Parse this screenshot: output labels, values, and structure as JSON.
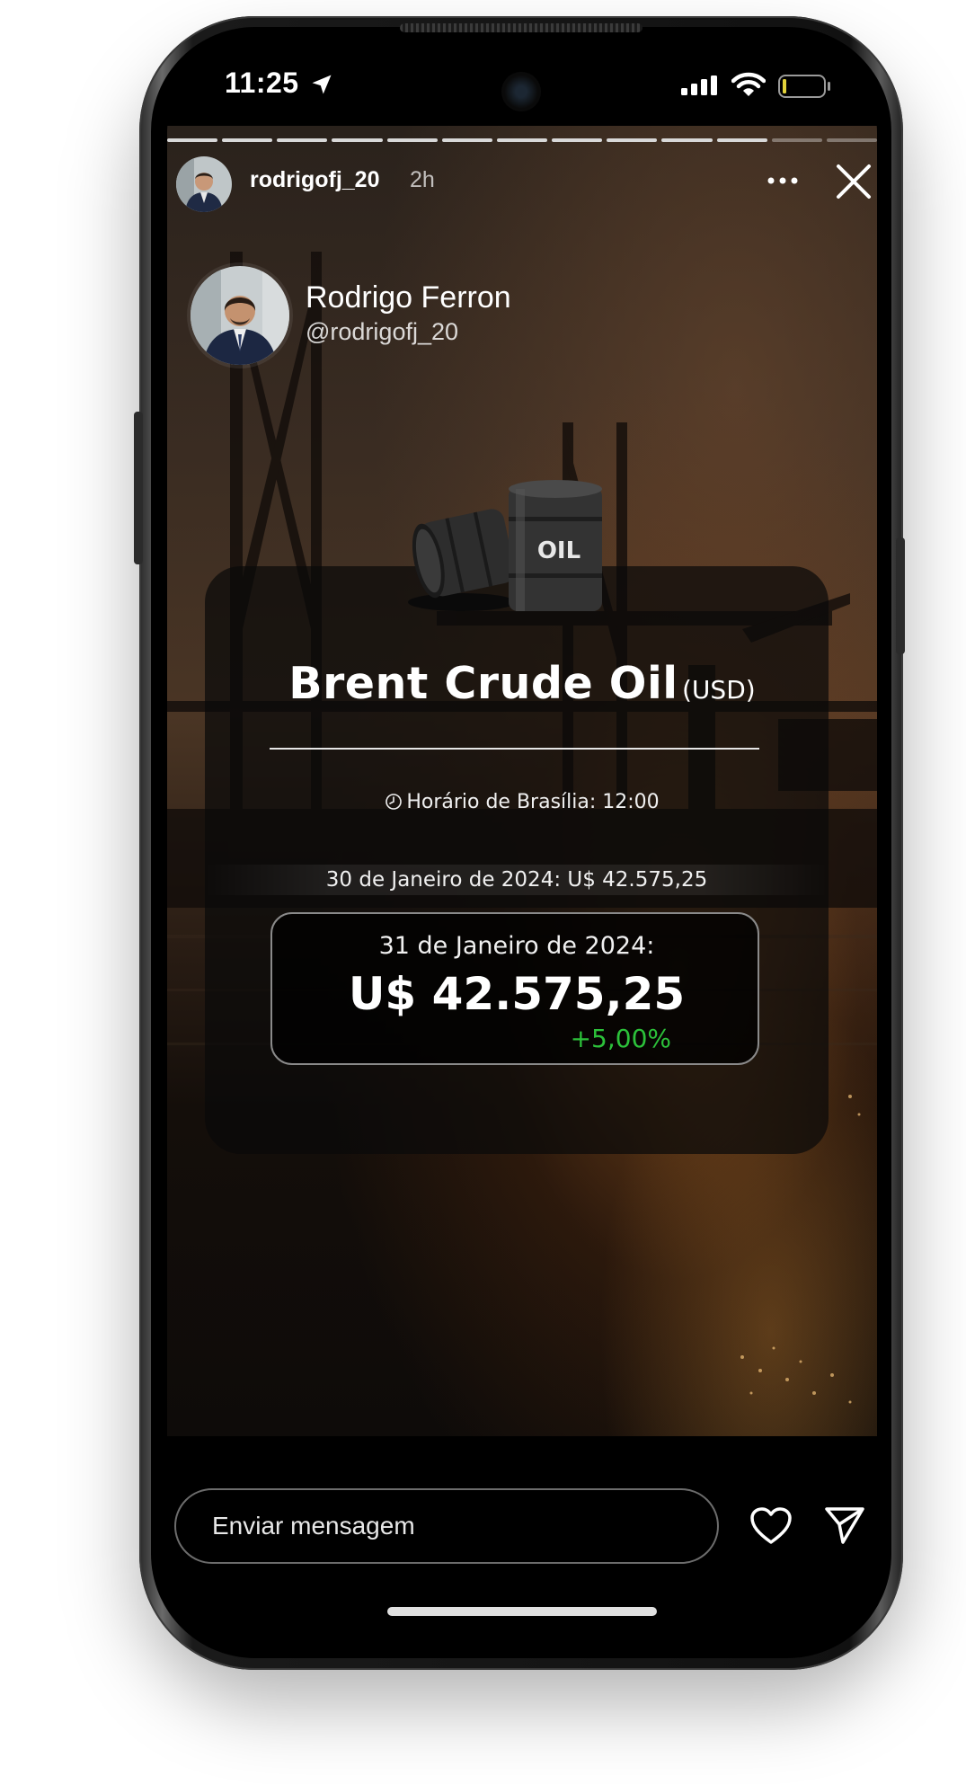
{
  "status_bar": {
    "time": "11:25"
  },
  "story": {
    "username": "rodrigofj_20",
    "posted_ago": "2h",
    "progress_segments_total": 13,
    "progress_segments_viewed": 11
  },
  "author": {
    "name": "Rodrigo Ferron",
    "handle": "@rodrigofj_20"
  },
  "card": {
    "barrel_label": "OIL",
    "title": "Brent Crude Oil",
    "title_unit": "(USD)",
    "time_label": "Horário de Brasília: 12:00",
    "previous": "30 de Janeiro de 2024: U$ 42.575,25",
    "current_date": "31 de Janeiro de 2024:",
    "current_value": "U$ 42.575,25",
    "change": "+5,00%"
  },
  "reply": {
    "placeholder": "Enviar mensagem"
  },
  "colors": {
    "positive": "#2cc13a",
    "background": "#000000"
  },
  "icons": [
    "location-arrow-icon",
    "signal-icon",
    "wifi-icon",
    "battery-icon",
    "more-icon",
    "close-icon",
    "clock-icon",
    "heart-icon",
    "send-icon"
  ]
}
